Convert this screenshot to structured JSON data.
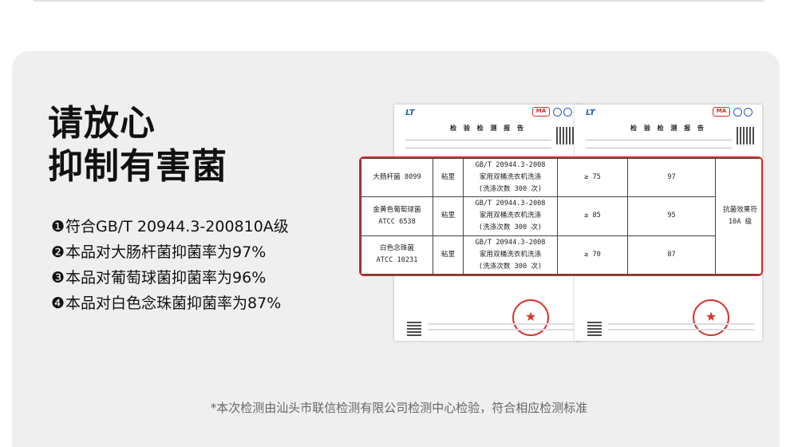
{
  "headline": {
    "line1": "请放心",
    "line2": "抑制有害菌"
  },
  "bullets": [
    {
      "num": "❶",
      "text": "符合GB/T 20944.3-200810A级"
    },
    {
      "num": "❷",
      "text": "本品对大肠杆菌抑菌率为97%"
    },
    {
      "num": "❸",
      "text": "本品对葡萄球菌抑菌率为96%"
    },
    {
      "num": "❹",
      "text": "本品对白色念珠菌抑菌率为87%"
    }
  ],
  "report": {
    "logo": "LT",
    "title": "检 验 检 测 报 告",
    "cma": "MA",
    "stamp_icon": "star-icon"
  },
  "table": {
    "rows": [
      {
        "bacteria": [
          "大肠杆菌 8099"
        ],
        "method": "粘里",
        "std": [
          "GB/T 20944.3-2008",
          "家用双桶洗衣机洗涤",
          "(洗涤次数 300 次)"
        ],
        "req": "≥ 75",
        "result": "97"
      },
      {
        "bacteria": [
          "金黄色葡萄球菌",
          "ATCC 6538"
        ],
        "method": "粘里",
        "std": [
          "GB/T 20944.3-2008",
          "家用双桶洗衣机洗涤",
          "(洗涤次数 300 次)"
        ],
        "req": "≥ 85",
        "result": "95"
      },
      {
        "bacteria": [
          "白色念珠菌",
          "ATCC 10231"
        ],
        "method": "粘里",
        "std": [
          "GB/T 20944.3-2008",
          "家用双桶洗衣机洗涤",
          "(洗涤次数 300 次)"
        ],
        "req": "≥ 70",
        "result": "87"
      }
    ],
    "conclusion": [
      "抗菌效果符",
      "10A 级"
    ]
  },
  "footnote": "*本次检测由汕头市联信检测有限公司检测中心检验，符合相应检测标准",
  "colors": {
    "panel_bg": "#efefef",
    "highlight_border": "#d62828",
    "stamp": "#d8342c",
    "logo_blue": "#1f5fb0"
  }
}
